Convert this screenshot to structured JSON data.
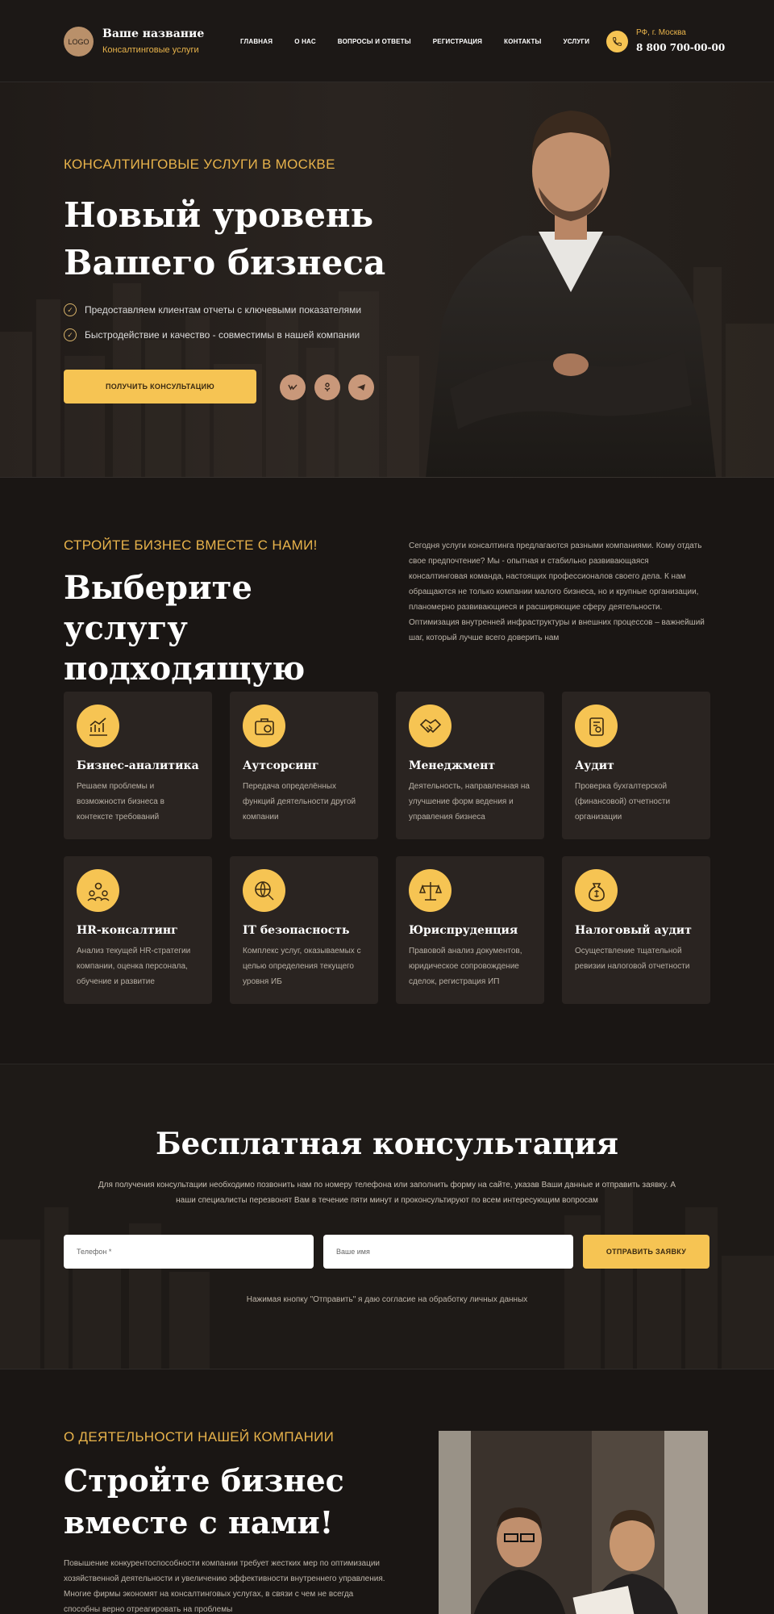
{
  "header": {
    "logo_text": "LOGO",
    "brand_name": "Ваше название",
    "brand_sub": "Консалтинговые услуги",
    "nav": [
      "ГЛАВНАЯ",
      "О НАС",
      "ВОПРОСЫ И ОТВЕТЫ",
      "РЕГИСТРАЦИЯ",
      "КОНТАКТЫ",
      "УСЛУГИ"
    ],
    "menu_icon": "≡",
    "city": "РФ, г. Москва",
    "phone": "8 800 700-00-00"
  },
  "hero": {
    "kicker": "КОНСАЛТИНГОВЫЕ УСЛУГИ В МОСКВЕ",
    "title": "Новый уровень Вашего бизнеса",
    "points": [
      "Предоставляем клиентам отчеты с ключевыми показателями",
      "Быстродействие и качество - совместимы в нашей компании"
    ],
    "cta": "ПОЛУЧИТЬ КОНСУЛЬТАЦИЮ",
    "social": [
      "vk",
      "ok",
      "tg"
    ]
  },
  "services": {
    "kicker": "СТРОЙТЕ БИЗНЕС ВМЕСТЕ С НАМИ!",
    "title": "Выберите услугу подходящую Вам",
    "description": "Сегодня услуги консалтинга предлагаются разными компаниями. Кому отдать свое предпочтение? Мы - опытная и стабильно развивающаяся консалтинговая команда, настоящих профессионалов своего дела. К нам обращаются не только компании малого бизнеса, но и крупные организации, планомерно развивающиеся и расширяющие сферу деятельности. Оптимизация внутренней инфраструктуры и внешних процессов – важнейший шаг, который лучше всего доверить нам",
    "cards": [
      {
        "icon": "chart-icon",
        "title": "Бизнес-аналитика",
        "text": "Решаем проблемы и возможности бизнеса в контексте требований"
      },
      {
        "icon": "briefcase-icon",
        "title": "Аутсорсинг",
        "text": "Передача определённых функций деятельности другой компании"
      },
      {
        "icon": "handshake-icon",
        "title": "Менеджмент",
        "text": "Деятельность, направленная на улучшение форм ведения и управления бизнеса"
      },
      {
        "icon": "audit-icon",
        "title": "Аудит",
        "text": "Проверка бухгалтерской (финансовой) отчетности организации"
      },
      {
        "icon": "people-icon",
        "title": "HR-консалтинг",
        "text": "Анализ текущей HR-стратегии компании, оценка персонала, обучение и развитие"
      },
      {
        "icon": "globe-search-icon",
        "title": "IT безопасность",
        "text": "Комплекс услуг, оказываемых с целью определения текущего уровня ИБ"
      },
      {
        "icon": "scales-icon",
        "title": "Юриспруденция",
        "text": "Правовой анализ документов, юридическое сопровождение сделок, регистрация ИП"
      },
      {
        "icon": "money-bag-icon",
        "title": "Налоговый аудит",
        "text": "Осуществление тщательной ревизии налоговой отчетности"
      }
    ]
  },
  "consult": {
    "title": "Бесплатная консультация",
    "description": "Для получения консультации необходимо позвонить нам по номеру телефона или заполнить форму на сайте, указав Ваши данные и отправить заявку. А наши специалисты перезвонят Вам в течение пяти минут и проконсультируют по всем интересующим вопросам",
    "phone_placeholder": "Телефон *",
    "name_placeholder": "Ваше имя",
    "submit": "ОТПРАВИТЬ ЗАЯВКУ",
    "consent": "Нажимая кнопку \"Отправить\" я даю согласие на обработку личных данных"
  },
  "about": {
    "kicker": "О ДЕЯТЕЛЬНОСТИ НАШЕЙ КОМПАНИИ",
    "title": "Стройте бизнес вместе с нами!",
    "description": "Повышение конкурентоспособности компании требует жестких мер по оптимизации хозяйственной деятельности и увеличению эффективности внутреннего управления. Многие фирмы экономят на консалтинговых услугах, в связи с чем не всегда способны верно отреагировать на проблемы"
  },
  "colors": {
    "accent": "#f6c453",
    "gold_text": "#e8b34b",
    "background": "#1a1614",
    "card": "#2a2421"
  }
}
